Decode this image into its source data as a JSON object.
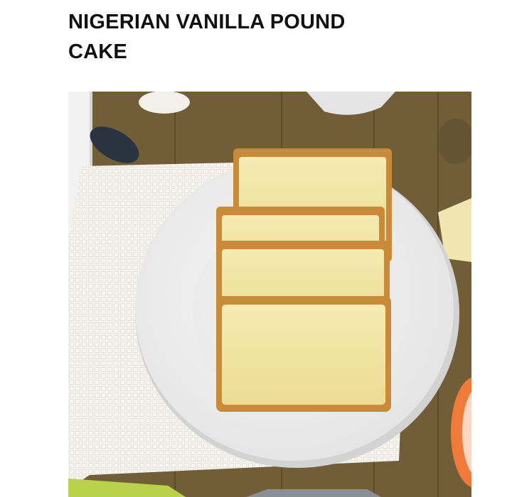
{
  "recipe": {
    "title": "NIGERIAN VANILLA POUND CAKE",
    "photo": {
      "subject": "pound-cake-slices-on-plate",
      "colors": {
        "table": "#6e5a36",
        "towel": "#f4f2ec",
        "plate": "#f1f1f1",
        "crumb": "#f3e6a8",
        "crust": "#c98a3a",
        "accent_orange": "#f07a3a",
        "accent_green": "#b9d24a"
      }
    }
  }
}
